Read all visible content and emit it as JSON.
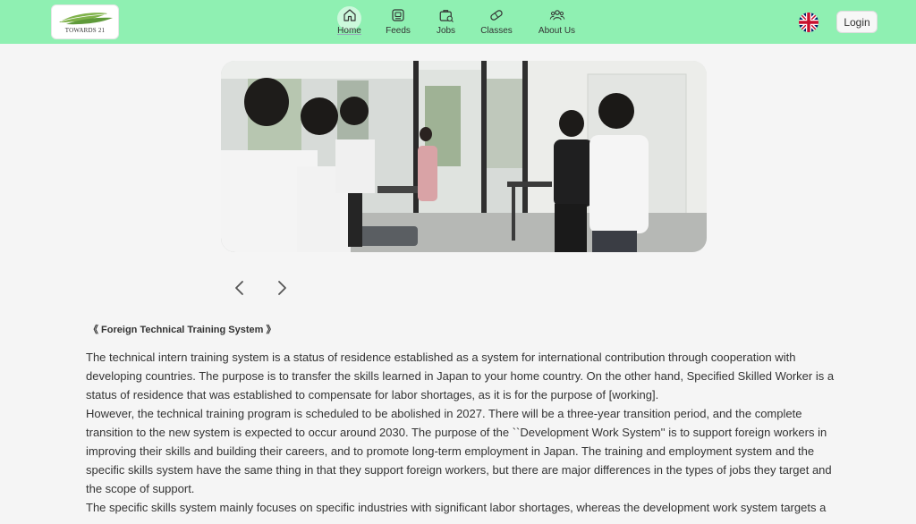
{
  "header": {
    "logo_text": "TOWARDS 21",
    "nav": [
      {
        "label": "Home",
        "icon": "home-icon",
        "active": true
      },
      {
        "label": "Feeds",
        "icon": "feeds-icon"
      },
      {
        "label": "Jobs",
        "icon": "jobs-icon"
      },
      {
        "label": "Classes",
        "icon": "classes-icon"
      },
      {
        "label": "About Us",
        "icon": "about-us-icon"
      }
    ],
    "language_icon": "uk-flag-icon",
    "login_label": "Login"
  },
  "carousel": {
    "prev_icon": "chevron-left-icon",
    "next_icon": "chevron-right-icon"
  },
  "article": {
    "title": "《 Foreign Technical Training System 》",
    "lines": [
      "The technical intern training system is a status of residence established as a system for international contribution through cooperation with",
      "developing countries. The purpose is to transfer the skills learned in Japan to your home country. On the other hand, Specified Skilled Worker is a",
      "status of residence that was established to compensate for labor shortages, as it is for the purpose of [working].",
      "However, the technical training program is scheduled to be abolished in 2027. There will be a three-year transition period, and the complete",
      "transition to the new system is expected to occur around 2030. The purpose of the ``Development Work System'' is to support foreign workers in",
      "improving their skills and building their careers, and to promote long-term employment in Japan. The training and employment system and the",
      "specific skills system have the same thing in that they support foreign workers, but there are major differences in the types of jobs they target and",
      "the scope of support.",
      "The specific skills system mainly focuses on specific industries with significant labor shortages, whereas the development work system targets a"
    ]
  },
  "colors": {
    "navbar": "#8ff0b2",
    "page_background": "#f5f5f5",
    "text": "#333333"
  }
}
